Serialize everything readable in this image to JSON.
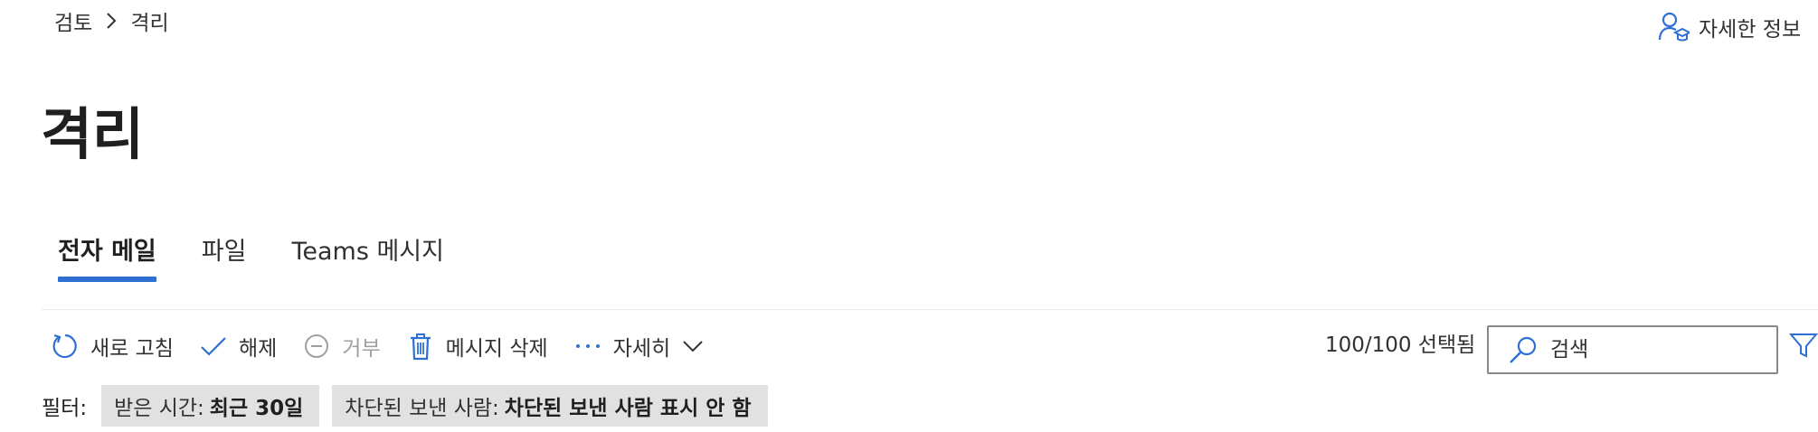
{
  "breadcrumb": {
    "items": [
      "검토",
      "격리"
    ]
  },
  "header": {
    "learn_more": "자세한 정보"
  },
  "page": {
    "title": "격리"
  },
  "tabs": [
    {
      "label": "전자 메일",
      "active": true
    },
    {
      "label": "파일",
      "active": false
    },
    {
      "label": "Teams 메시지",
      "active": false
    }
  ],
  "toolbar": {
    "refresh": "새로 고침",
    "release": "해제",
    "deny": "거부",
    "delete_messages": "메시지 삭제",
    "more": "자세히",
    "selected": "100/100 선택됨"
  },
  "search": {
    "placeholder": "검색"
  },
  "filters": {
    "label": "필터:",
    "chips": [
      {
        "key": "받은 시간:",
        "value": "최근 30일"
      },
      {
        "key": "차단된 보낸 사람:",
        "value": "차단된 보낸 사람 표시 안 함"
      }
    ]
  },
  "colors": {
    "accent": "#2d6fd2",
    "chip_bg": "#e1e1e1",
    "disabled": "#a19f9d"
  }
}
